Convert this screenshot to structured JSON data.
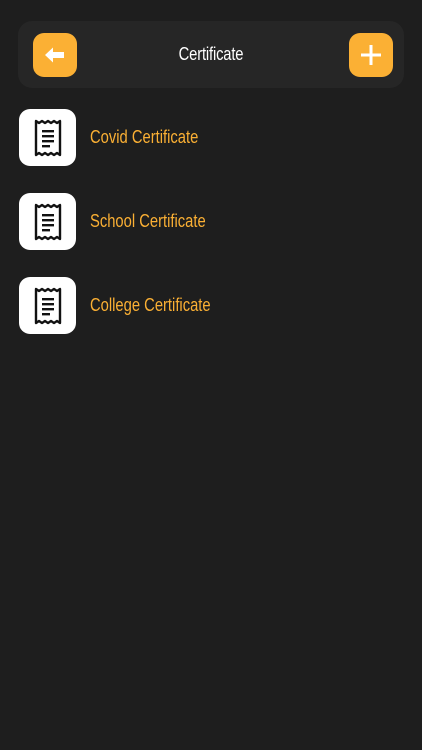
{
  "header": {
    "title": "Certificate",
    "back_icon": "arrow-left-icon",
    "add_icon": "plus-icon"
  },
  "certificates": [
    {
      "label": "Covid Certificate",
      "icon": "receipt-icon"
    },
    {
      "label": "School Certificate",
      "icon": "receipt-icon"
    },
    {
      "label": "College Certificate",
      "icon": "receipt-icon"
    }
  ],
  "colors": {
    "background": "#1e1e1e",
    "header_bg": "#262626",
    "accent": "#fbb034",
    "title_text": "#ffffff",
    "icon_tile": "#ffffff"
  }
}
